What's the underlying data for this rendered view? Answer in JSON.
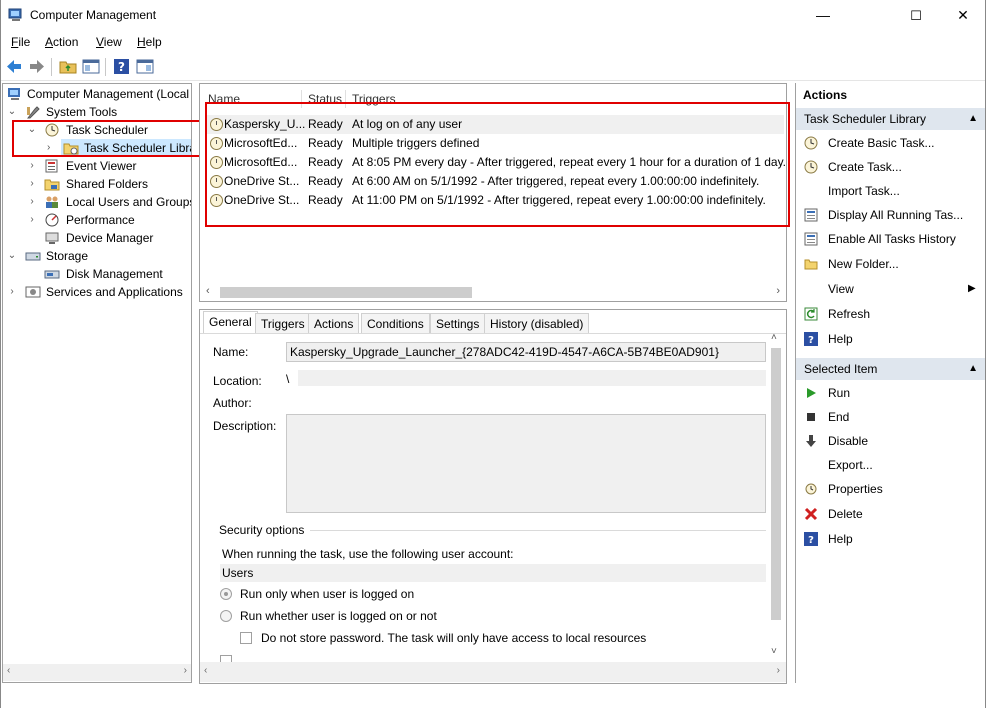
{
  "window": {
    "title": "Computer Management",
    "minimize": "—",
    "maximize": "☐",
    "close": "✕"
  },
  "menu": [
    {
      "key": "F",
      "rest": "ile"
    },
    {
      "key": "A",
      "rest": "ction"
    },
    {
      "key": "V",
      "rest": "iew"
    },
    {
      "key": "H",
      "rest": "elp"
    }
  ],
  "tree": {
    "root": "Computer Management (Local",
    "system_tools": "System Tools",
    "task_scheduler": "Task Scheduler",
    "task_scheduler_library": "Task Scheduler Libra",
    "event_viewer": "Event Viewer",
    "shared_folders": "Shared Folders",
    "local_users": "Local Users and Groups",
    "performance": "Performance",
    "device_manager": "Device Manager",
    "storage": "Storage",
    "disk_management": "Disk Management",
    "services_apps": "Services and Applications"
  },
  "list": {
    "columns": {
      "name": "Name",
      "status": "Status",
      "triggers": "Triggers"
    },
    "rows": [
      {
        "name": "Kaspersky_U...",
        "status": "Ready",
        "triggers": "At log on of any user"
      },
      {
        "name": "MicrosoftEd...",
        "status": "Ready",
        "triggers": "Multiple triggers defined"
      },
      {
        "name": "MicrosoftEd...",
        "status": "Ready",
        "triggers": "At 8:05 PM every day - After triggered, repeat every 1 hour for a duration of 1 day."
      },
      {
        "name": "OneDrive St...",
        "status": "Ready",
        "triggers": "At 6:00 AM on 5/1/1992 - After triggered, repeat every 1.00:00:00 indefinitely."
      },
      {
        "name": "OneDrive St...",
        "status": "Ready",
        "triggers": "At 11:00 PM on 5/1/1992 - After triggered, repeat every 1.00:00:00 indefinitely."
      }
    ]
  },
  "detail": {
    "tabs": [
      "General",
      "Triggers",
      "Actions",
      "Conditions",
      "Settings",
      "History (disabled)"
    ],
    "name_label": "Name:",
    "name_value": "Kaspersky_Upgrade_Launcher_{278ADC42-419D-4547-A6CA-5B74BE0AD901}",
    "location_label": "Location:",
    "location_value": "\\",
    "author_label": "Author:",
    "description_label": "Description:",
    "security_options": "Security options",
    "user_account_text": "When running the task, use the following user account:",
    "user_account_value": "Users",
    "radio_logged_on": "Run only when user is logged on",
    "radio_whether": "Run whether user is logged on or not",
    "chk_no_store": "Do not store password.  The task will only have access to local resources"
  },
  "actions": {
    "title": "Actions",
    "section1": "Task Scheduler Library",
    "items1": [
      "Create Basic Task...",
      "Create Task...",
      "Import Task...",
      "Display All Running Tas...",
      "Enable All Tasks History",
      "New Folder...",
      "View",
      "Refresh",
      "Help"
    ],
    "section2": "Selected Item",
    "items2": [
      "Run",
      "End",
      "Disable",
      "Export...",
      "Properties",
      "Delete",
      "Help"
    ]
  }
}
